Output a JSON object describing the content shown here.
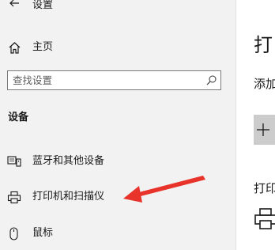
{
  "window": {
    "title": "设置"
  },
  "sidebar": {
    "home_label": "主页",
    "search_placeholder": "查找设置",
    "section_heading": "设备",
    "items": [
      {
        "label": "蓝牙和其他设备",
        "icon": "bluetooth-devices-icon"
      },
      {
        "label": "打印机和扫描仪",
        "icon": "printer-icon"
      },
      {
        "label": "鼠标",
        "icon": "mouse-icon"
      }
    ]
  },
  "main": {
    "heading": "打",
    "add_text": "添加",
    "sub2_text": "打印"
  },
  "colors": {
    "sidebar_bg": "#f2f2f2",
    "annotation_arrow": "#e8332a",
    "add_button_bg": "#cccccc"
  }
}
